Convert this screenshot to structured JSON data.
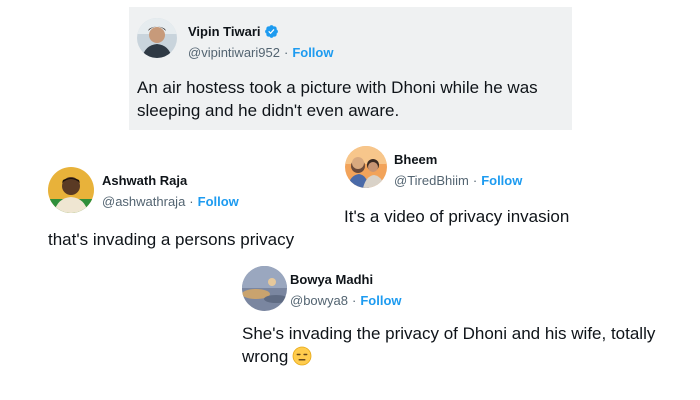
{
  "tweets": [
    {
      "name": "Vipin Tiwari",
      "handle": "@vipintiwari952",
      "separator": "·",
      "follow": "Follow",
      "text": "An air hostess took a picture with Dhoni while he was sleeping and he didn't even aware."
    },
    {
      "name": "Bheem",
      "handle": "@TiredBhiim",
      "separator": "·",
      "follow": "Follow",
      "text": "It's a video of privacy invasion"
    },
    {
      "name": "Ashwath Raja",
      "handle": "@ashwathraja",
      "separator": "·",
      "follow": "Follow",
      "text": "that's invading a persons privacy"
    },
    {
      "name": "Bowya Madhi",
      "handle": "@bowya8",
      "separator": "·",
      "follow": "Follow",
      "text": "She's invading the privacy of Dhoni and his wife, totally wrong"
    }
  ],
  "colors": {
    "follow": "#1d9bf0",
    "handle": "#536471",
    "text": "#0f1419",
    "main_card_bg": "#eff1f2"
  },
  "icons": {
    "verified": "verified-badge-icon",
    "emoji": "expressionless-face-emoji"
  }
}
